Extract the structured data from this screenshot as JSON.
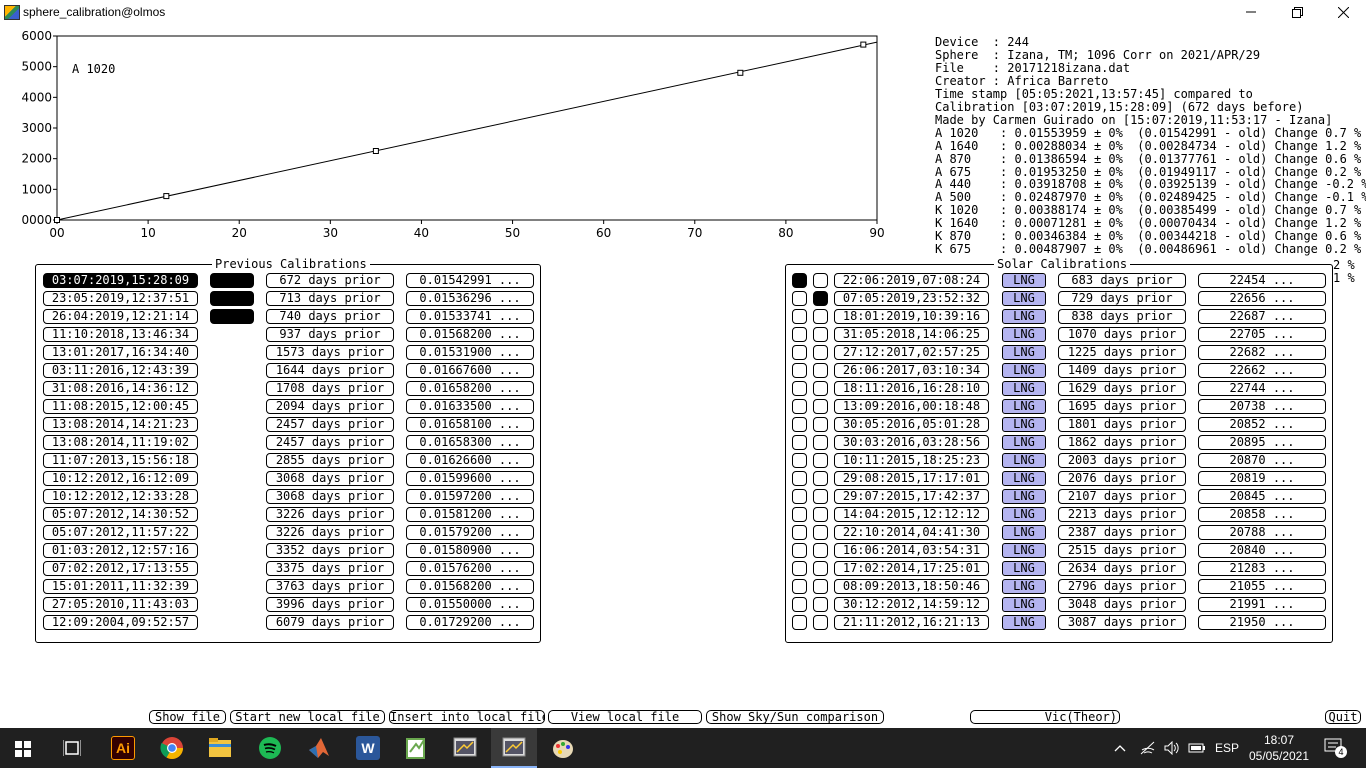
{
  "window": {
    "title": "sphere_calibration@olmos",
    "minimize_icon": "minimize-icon",
    "restore_icon": "restore-icon",
    "close_icon": "close-icon"
  },
  "chart_data": {
    "type": "scatter",
    "title": "",
    "annotation": "A 1020",
    "xlim": [
      0,
      90
    ],
    "ylim": [
      0,
      6000
    ],
    "x_ticks": [
      "00",
      "10",
      "20",
      "30",
      "40",
      "50",
      "60",
      "70",
      "80",
      "90"
    ],
    "y_ticks": [
      "0000",
      "1000",
      "2000",
      "3000",
      "4000",
      "5000",
      "6000"
    ],
    "series": [
      {
        "points": [
          [
            0,
            0
          ],
          [
            12,
            780
          ],
          [
            35,
            2250
          ],
          [
            75,
            4800
          ],
          [
            88.5,
            5720
          ]
        ]
      }
    ],
    "fit_line": [
      [
        0,
        0
      ],
      [
        90,
        5800
      ]
    ]
  },
  "info": {
    "lines": [
      "Device  : 244",
      "Sphere  : Izana, TM; 1096 Corr on 2021/APR/29",
      "File    : 20171218izana.dat",
      "Creator : Africa Barreto",
      "Time stamp [05:05:2021,13:57:45] compared to",
      "Calibration [03:07:2019,15:28:09] (672 days before)",
      "Made by Carmen Guirado on [15:07:2019,11:53:17 - Izana]",
      "A 1020   : 0.01553959 ± 0%  (0.01542991 - old) Change 0.7 %",
      "A 1640   : 0.00288034 ± 0%  (0.00284734 - old) Change 1.2 %",
      "A 870    : 0.01386594 ± 0%  (0.01377761 - old) Change 0.6 %",
      "A 675    : 0.01953250 ± 0%  (0.01949117 - old) Change 0.2 %",
      "A 440    : 0.03918708 ± 0%  (0.03925139 - old) Change -0.2 %",
      "A 500    : 0.02487970 ± 0%  (0.02489425 - old) Change -0.1 %",
      "K 1020   : 0.00388174 ± 0%  (0.00385499 - old) Change 0.7 %",
      "K 1640   : 0.00071281 ± 0%  (0.00070434 - old) Change 1.2 %",
      "K 870    : 0.00346384 ± 0%  (0.00344218 - old) Change 0.6 %",
      "K 675    : 0.00487907 ± 0%  (0.00486961 - old) Change 0.2 %"
    ],
    "overflow_1": "2 %",
    "overflow_2": "1 %"
  },
  "previous": {
    "title": "Previous Calibrations",
    "rows": [
      {
        "date": "03:07:2019,15:28:09",
        "days": "672 days prior",
        "value": "0.01542991 ...",
        "selected": true,
        "flag": true
      },
      {
        "date": "23:05:2019,12:37:51",
        "days": "713 days prior",
        "value": "0.01536296 ...",
        "selected": false,
        "flag": true
      },
      {
        "date": "26:04:2019,12:21:14",
        "days": "740 days prior",
        "value": "0.01533741 ...",
        "selected": false,
        "flag": true
      },
      {
        "date": "11:10:2018,13:46:34",
        "days": "937 days prior",
        "value": "0.01568200 ...",
        "selected": false,
        "flag": false
      },
      {
        "date": "13:01:2017,16:34:40",
        "days": "1573 days prior",
        "value": "0.01531900 ...",
        "selected": false,
        "flag": false
      },
      {
        "date": "03:11:2016,12:43:39",
        "days": "1644 days prior",
        "value": "0.01667600 ...",
        "selected": false,
        "flag": false
      },
      {
        "date": "31:08:2016,14:36:12",
        "days": "1708 days prior",
        "value": "0.01658200 ...",
        "selected": false,
        "flag": false
      },
      {
        "date": "11:08:2015,12:00:45",
        "days": "2094 days prior",
        "value": "0.01633500 ...",
        "selected": false,
        "flag": false
      },
      {
        "date": "13:08:2014,14:21:23",
        "days": "2457 days prior",
        "value": "0.01658100 ...",
        "selected": false,
        "flag": false
      },
      {
        "date": "13:08:2014,11:19:02",
        "days": "2457 days prior",
        "value": "0.01658300 ...",
        "selected": false,
        "flag": false
      },
      {
        "date": "11:07:2013,15:56:18",
        "days": "2855 days prior",
        "value": "0.01626600 ...",
        "selected": false,
        "flag": false
      },
      {
        "date": "10:12:2012,16:12:09",
        "days": "3068 days prior",
        "value": "0.01599600 ...",
        "selected": false,
        "flag": false
      },
      {
        "date": "10:12:2012,12:33:28",
        "days": "3068 days prior",
        "value": "0.01597200 ...",
        "selected": false,
        "flag": false
      },
      {
        "date": "05:07:2012,14:30:52",
        "days": "3226 days prior",
        "value": "0.01581200 ...",
        "selected": false,
        "flag": false
      },
      {
        "date": "05:07:2012,11:57:22",
        "days": "3226 days prior",
        "value": "0.01579200 ...",
        "selected": false,
        "flag": false
      },
      {
        "date": "01:03:2012,12:57:16",
        "days": "3352 days prior",
        "value": "0.01580900 ...",
        "selected": false,
        "flag": false
      },
      {
        "date": "07:02:2012,17:13:55",
        "days": "3375 days prior",
        "value": "0.01576200 ...",
        "selected": false,
        "flag": false
      },
      {
        "date": "15:01:2011,11:32:39",
        "days": "3763 days prior",
        "value": "0.01568200 ...",
        "selected": false,
        "flag": false
      },
      {
        "date": "27:05:2010,11:43:03",
        "days": "3996 days prior",
        "value": "0.01550000 ...",
        "selected": false,
        "flag": false
      },
      {
        "date": "12:09:2004,09:52:57",
        "days": "6079 days prior",
        "value": "0.01729200 ...",
        "selected": false,
        "flag": false
      }
    ]
  },
  "solar": {
    "title": "Solar Calibrations",
    "tag": "LNG",
    "rows": [
      {
        "c1": true,
        "c2": false,
        "date": "22:06:2019,07:08:24",
        "days": "683 days prior",
        "num": "22454 ..."
      },
      {
        "c1": false,
        "c2": true,
        "date": "07:05:2019,23:52:32",
        "days": "729 days prior",
        "num": "22656 ..."
      },
      {
        "c1": false,
        "c2": false,
        "date": "18:01:2019,10:39:16",
        "days": "838 days prior",
        "num": "22687 ..."
      },
      {
        "c1": false,
        "c2": false,
        "date": "31:05:2018,14:06:25",
        "days": "1070 days prior",
        "num": "22705 ..."
      },
      {
        "c1": false,
        "c2": false,
        "date": "27:12:2017,02:57:25",
        "days": "1225 days prior",
        "num": "22682 ..."
      },
      {
        "c1": false,
        "c2": false,
        "date": "26:06:2017,03:10:34",
        "days": "1409 days prior",
        "num": "22662 ..."
      },
      {
        "c1": false,
        "c2": false,
        "date": "18:11:2016,16:28:10",
        "days": "1629 days prior",
        "num": "22744 ..."
      },
      {
        "c1": false,
        "c2": false,
        "date": "13:09:2016,00:18:48",
        "days": "1695 days prior",
        "num": "20738 ..."
      },
      {
        "c1": false,
        "c2": false,
        "date": "30:05:2016,05:01:28",
        "days": "1801 days prior",
        "num": "20852 ..."
      },
      {
        "c1": false,
        "c2": false,
        "date": "30:03:2016,03:28:56",
        "days": "1862 days prior",
        "num": "20895 ..."
      },
      {
        "c1": false,
        "c2": false,
        "date": "10:11:2015,18:25:23",
        "days": "2003 days prior",
        "num": "20870 ..."
      },
      {
        "c1": false,
        "c2": false,
        "date": "29:08:2015,17:17:01",
        "days": "2076 days prior",
        "num": "20819 ..."
      },
      {
        "c1": false,
        "c2": false,
        "date": "29:07:2015,17:42:37",
        "days": "2107 days prior",
        "num": "20845 ..."
      },
      {
        "c1": false,
        "c2": false,
        "date": "14:04:2015,12:12:12",
        "days": "2213 days prior",
        "num": "20858 ..."
      },
      {
        "c1": false,
        "c2": false,
        "date": "22:10:2014,04:41:30",
        "days": "2387 days prior",
        "num": "20788 ..."
      },
      {
        "c1": false,
        "c2": false,
        "date": "16:06:2014,03:54:31",
        "days": "2515 days prior",
        "num": "20840 ..."
      },
      {
        "c1": false,
        "c2": false,
        "date": "17:02:2014,17:25:01",
        "days": "2634 days prior",
        "num": "21283 ..."
      },
      {
        "c1": false,
        "c2": false,
        "date": "08:09:2013,18:50:46",
        "days": "2796 days prior",
        "num": "21055 ..."
      },
      {
        "c1": false,
        "c2": false,
        "date": "30:12:2012,14:59:12",
        "days": "3048 days prior",
        "num": "21991 ..."
      },
      {
        "c1": false,
        "c2": false,
        "date": "21:11:2012,16:21:13",
        "days": "3087 days prior",
        "num": "21950 ..."
      }
    ]
  },
  "buttons": {
    "show_file": "Show file",
    "start_new": "Start new local file",
    "insert": "Insert into local file",
    "view_local": "View local file",
    "show_sky_sun": "Show Sky/Sun comparison",
    "vic": "Vic(Theor)",
    "quit": "Quit"
  },
  "taskbar": {
    "apps": [
      "start-icon",
      "task-view-icon",
      "illustrator-icon",
      "chrome-icon",
      "file-explorer-icon",
      "spotify-icon",
      "matlab-icon",
      "word-icon",
      "notepad-plus-icon",
      "xming-icon",
      "xming-active-icon",
      "paint-icon"
    ],
    "illustrator_label": "Ai",
    "word_label": "W",
    "language": "ESP",
    "time": "18:07",
    "date": "05/05/2021",
    "notifications": "4",
    "colors": {
      "bar": "#202020",
      "active": "#3a3a3a"
    }
  }
}
